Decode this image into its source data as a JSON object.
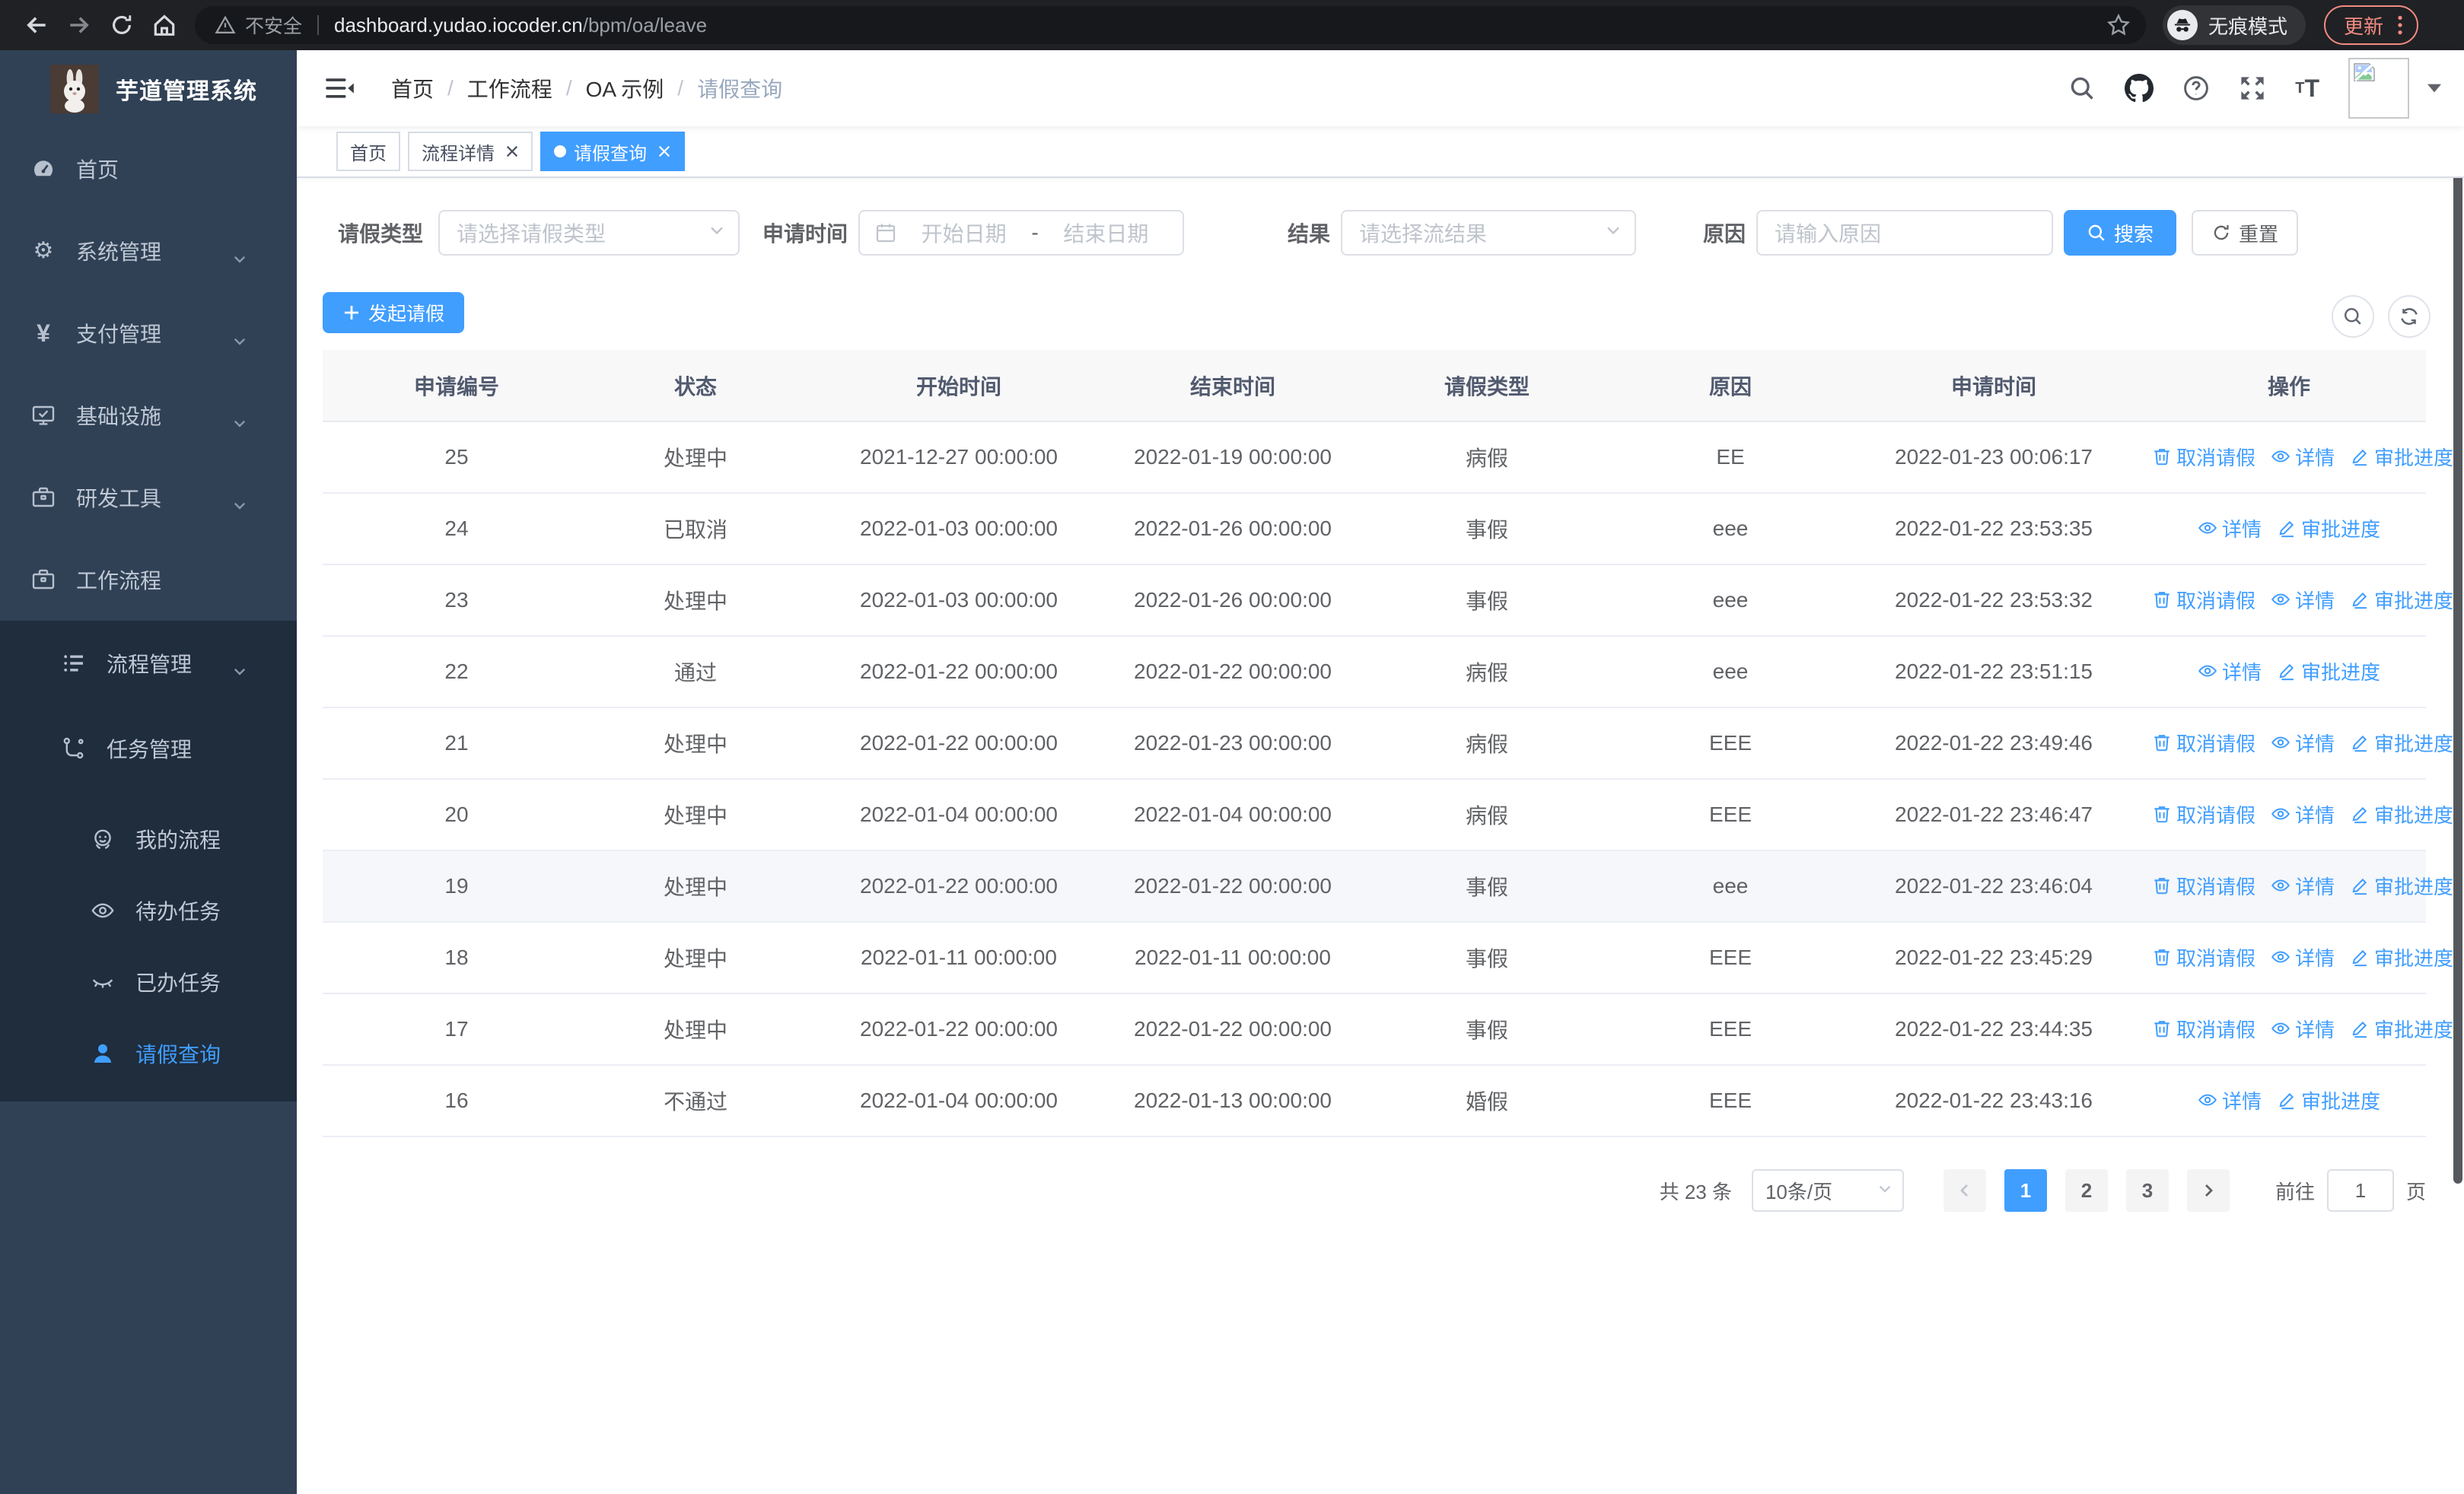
{
  "browser": {
    "security_label": "不安全",
    "url_host": "dashboard.yudao.iocoder.cn",
    "url_path": "/bpm/oa/leave",
    "incognito_label": "无痕模式",
    "update_label": "更新"
  },
  "colors": {
    "primary": "#409eff",
    "sidebar_bg": "#304156",
    "sidebar_submenu_bg": "#1f2d3d",
    "chrome_bg": "#202124",
    "update_accent": "#f28b82",
    "table_header_bg": "#f8f8f9",
    "link": "#409eff",
    "row_hover": "#f5f7fa"
  },
  "sidebar": {
    "title": "芋道管理系统",
    "items": [
      {
        "icon": "dashboard",
        "label": "首页",
        "level": 1
      },
      {
        "icon": "gear",
        "label": "系统管理",
        "level": 1,
        "chevron": "down"
      },
      {
        "icon": "yen",
        "label": "支付管理",
        "level": 1,
        "chevron": "down"
      },
      {
        "icon": "monitor",
        "label": "基础设施",
        "level": 1,
        "chevron": "down"
      },
      {
        "icon": "toolbox",
        "label": "研发工具",
        "level": 1,
        "chevron": "down"
      },
      {
        "icon": "briefcase",
        "label": "工作流程",
        "level": 1,
        "chevron": "up"
      },
      {
        "icon": "tree-list",
        "label": "流程管理",
        "level": 2,
        "chevron": "down"
      },
      {
        "icon": "flow",
        "label": "任务管理",
        "level": 2,
        "chevron": "up"
      },
      {
        "icon": "robot",
        "label": "我的流程",
        "level": 3
      },
      {
        "icon": "eye-open",
        "label": "待办任务",
        "level": 3
      },
      {
        "icon": "eye-closed",
        "label": "已办任务",
        "level": 3
      },
      {
        "icon": "user",
        "label": "请假查询",
        "level": 3,
        "active": true
      }
    ]
  },
  "header": {
    "breadcrumb": [
      "首页",
      "工作流程",
      "OA 示例",
      "请假查询"
    ]
  },
  "tabs": [
    {
      "label": "首页",
      "closable": false,
      "active": false
    },
    {
      "label": "流程详情",
      "closable": true,
      "active": false
    },
    {
      "label": "请假查询",
      "closable": true,
      "active": true
    }
  ],
  "filters": {
    "leave_type_label": "请假类型",
    "leave_type_placeholder": "请选择请假类型",
    "apply_time_label": "申请时间",
    "start_placeholder": "开始日期",
    "range_separator": "-",
    "end_placeholder": "结束日期",
    "result_label": "结果",
    "result_placeholder": "请选择流结果",
    "reason_label": "原因",
    "reason_placeholder": "请输入原因",
    "search_label": "搜索",
    "reset_label": "重置"
  },
  "actions_bar": {
    "create_label": "发起请假"
  },
  "table": {
    "columns": [
      "申请编号",
      "状态",
      "开始时间",
      "结束时间",
      "请假类型",
      "原因",
      "申请时间",
      "操作"
    ],
    "action_labels": {
      "cancel": "取消请假",
      "detail": "详情",
      "progress": "审批进度"
    },
    "rows": [
      {
        "id": "25",
        "status": "处理中",
        "start": "2021-12-27 00:00:00",
        "end": "2022-01-19 00:00:00",
        "type": "病假",
        "reason": "EE",
        "applied": "2022-01-23 00:06:17",
        "actions": [
          "cancel",
          "detail",
          "progress"
        ],
        "hover": false
      },
      {
        "id": "24",
        "status": "已取消",
        "start": "2022-01-03 00:00:00",
        "end": "2022-01-26 00:00:00",
        "type": "事假",
        "reason": "eee",
        "applied": "2022-01-22 23:53:35",
        "actions": [
          "detail",
          "progress"
        ],
        "hover": false
      },
      {
        "id": "23",
        "status": "处理中",
        "start": "2022-01-03 00:00:00",
        "end": "2022-01-26 00:00:00",
        "type": "事假",
        "reason": "eee",
        "applied": "2022-01-22 23:53:32",
        "actions": [
          "cancel",
          "detail",
          "progress"
        ],
        "hover": false
      },
      {
        "id": "22",
        "status": "通过",
        "start": "2022-01-22 00:00:00",
        "end": "2022-01-22 00:00:00",
        "type": "病假",
        "reason": "eee",
        "applied": "2022-01-22 23:51:15",
        "actions": [
          "detail",
          "progress"
        ],
        "hover": false
      },
      {
        "id": "21",
        "status": "处理中",
        "start": "2022-01-22 00:00:00",
        "end": "2022-01-23 00:00:00",
        "type": "病假",
        "reason": "EEE",
        "applied": "2022-01-22 23:49:46",
        "actions": [
          "cancel",
          "detail",
          "progress"
        ],
        "hover": false
      },
      {
        "id": "20",
        "status": "处理中",
        "start": "2022-01-04 00:00:00",
        "end": "2022-01-04 00:00:00",
        "type": "病假",
        "reason": "EEE",
        "applied": "2022-01-22 23:46:47",
        "actions": [
          "cancel",
          "detail",
          "progress"
        ],
        "hover": false
      },
      {
        "id": "19",
        "status": "处理中",
        "start": "2022-01-22 00:00:00",
        "end": "2022-01-22 00:00:00",
        "type": "事假",
        "reason": "eee",
        "applied": "2022-01-22 23:46:04",
        "actions": [
          "cancel",
          "detail",
          "progress"
        ],
        "hover": true
      },
      {
        "id": "18",
        "status": "处理中",
        "start": "2022-01-11 00:00:00",
        "end": "2022-01-11 00:00:00",
        "type": "事假",
        "reason": "EEE",
        "applied": "2022-01-22 23:45:29",
        "actions": [
          "cancel",
          "detail",
          "progress"
        ],
        "hover": false
      },
      {
        "id": "17",
        "status": "处理中",
        "start": "2022-01-22 00:00:00",
        "end": "2022-01-22 00:00:00",
        "type": "事假",
        "reason": "EEE",
        "applied": "2022-01-22 23:44:35",
        "actions": [
          "cancel",
          "detail",
          "progress"
        ],
        "hover": false
      },
      {
        "id": "16",
        "status": "不通过",
        "start": "2022-01-04 00:00:00",
        "end": "2022-01-13 00:00:00",
        "type": "婚假",
        "reason": "EEE",
        "applied": "2022-01-22 23:43:16",
        "actions": [
          "detail",
          "progress"
        ],
        "hover": false
      }
    ]
  },
  "pagination": {
    "total_text": "共 23 条",
    "page_size": "10条/页",
    "pages": [
      "1",
      "2",
      "3"
    ],
    "active_page": "1",
    "goto_label": "前往",
    "goto_value": "1",
    "goto_unit": "页"
  }
}
